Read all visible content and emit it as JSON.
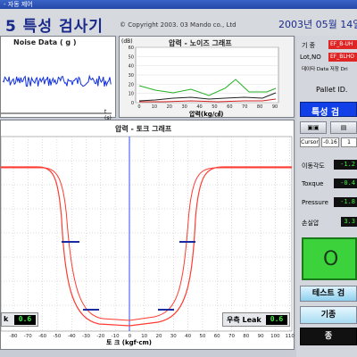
{
  "window": {
    "title": "- 자동 제어"
  },
  "header": {
    "app_title": "5 특성 검사기",
    "copyright": "© Copyright 2003. 03  Mando co., Ltd",
    "date": "2003년 05월 14일"
  },
  "noise_panel": {
    "title": "Noise Data ( g )",
    "xunit": "t (s)"
  },
  "pressure_noise_panel": {
    "title": "압력 - 노이즈 그래프",
    "yunit": "(dB)",
    "xlabel": "압력(kg/㎠)",
    "y_ticks": [
      "60",
      "50",
      "40",
      "30",
      "20",
      "10",
      "0"
    ],
    "x_ticks": [
      "0",
      "10",
      "20",
      "30",
      "40",
      "50",
      "60",
      "70",
      "80",
      "90"
    ]
  },
  "torque_panel": {
    "title": "압력 - 토크 그래프",
    "xlabel": "토 크 (kgf·cm)",
    "x_ticks": [
      "-80",
      "-70",
      "-60",
      "-50",
      "-40",
      "-30",
      "-20",
      "-10",
      "0",
      "10",
      "20",
      "30",
      "40",
      "50",
      "60",
      "70",
      "80",
      "90",
      "100",
      "110"
    ],
    "left_leak_label": "k",
    "left_leak_value": "0.6",
    "right_leak_label": "우측 Leak",
    "right_leak_value": "0.6"
  },
  "side_panel": {
    "gijong_label": "기 종",
    "gijong_value": "EF_B-UH",
    "lot_label": "Lot,NO",
    "lot_value": "EF_BLHO",
    "save_note": "데이타 Data 저장 Dri",
    "pallet_label": "Pallet ID.",
    "mode_display": "특성 검",
    "cursor_label": "Cursor",
    "cursor_value": "-0.16",
    "cursor_value2": "1",
    "angle_label": "이동각도",
    "angle_value": "-1.2",
    "torque_label": "Toxque",
    "torque_value": "-0.4",
    "pressure_label": "Pressure",
    "pressure_value": "-1.8",
    "loss_label": "손실압",
    "loss_value": "3.3",
    "status_text": "O",
    "test_button": "테스트 검",
    "base_button": "기종",
    "end_button": "종"
  },
  "colors": {
    "title_blue": "#1a2a8a",
    "noise_line": "#1030e0",
    "torque_curve": "#ff3b30",
    "status_green": "#3cd23c",
    "end_button_bg": "#111111"
  }
}
